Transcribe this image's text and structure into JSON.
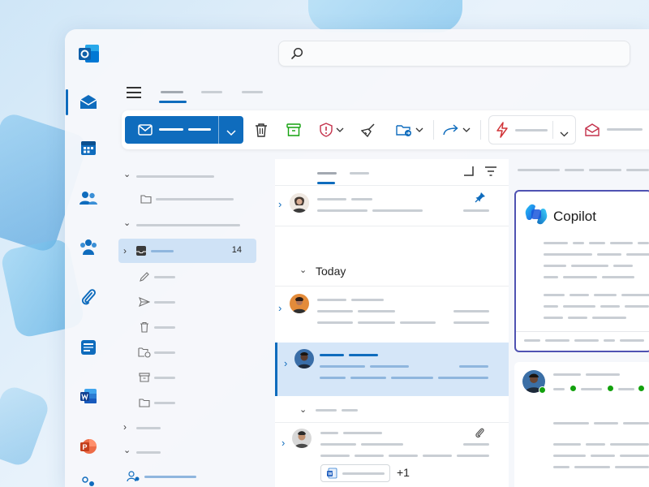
{
  "app": {
    "name": "Outlook"
  },
  "search": {
    "placeholder": ""
  },
  "message_list": {
    "group_today_label": "Today",
    "attachment_extra": "+1"
  },
  "folders": {
    "inbox_unread_count": "14"
  },
  "reading_pane": {
    "copilot_title": "Copilot"
  },
  "icons": {
    "rail": [
      "mail-icon",
      "calendar-icon",
      "people-icon",
      "groups-icon",
      "attachment-icon",
      "planner-icon",
      "word-icon",
      "powerpoint-icon"
    ],
    "ribbon": [
      "new-mail-icon",
      "delete-icon",
      "archive-icon",
      "report-icon",
      "sweep-icon",
      "move-icon",
      "forward-icon",
      "flag-icon",
      "read-unread-icon"
    ]
  },
  "colors": {
    "accent": "#0f6cbd",
    "selection": "#cfe2f6",
    "copilot_border": "#4f52b2",
    "presence_green": "#13a10e"
  }
}
